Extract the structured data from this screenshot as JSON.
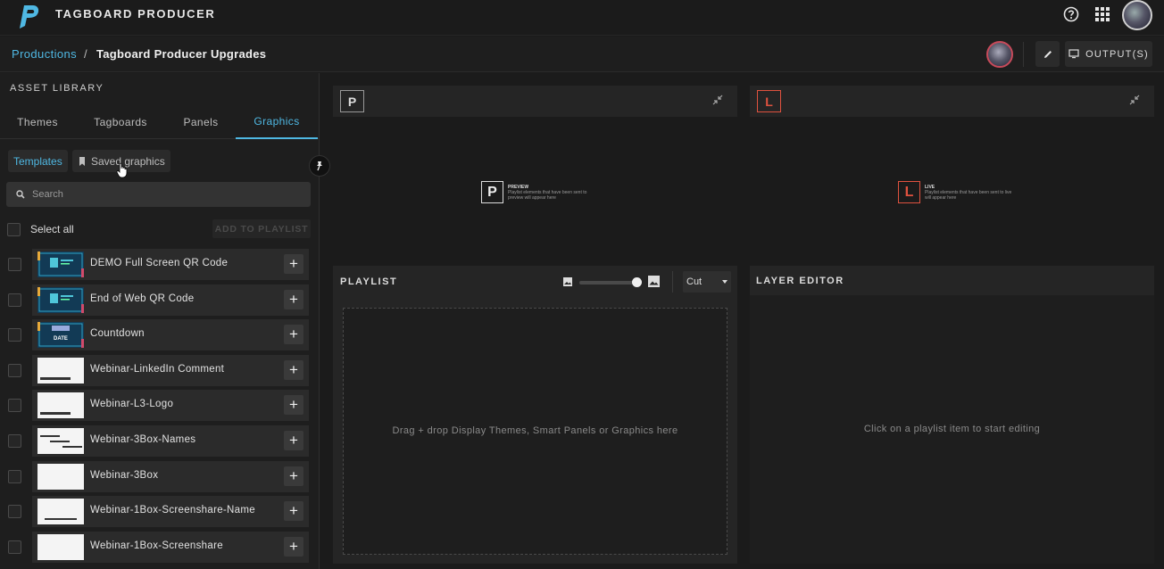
{
  "app": {
    "title": "TAGBOARD PRODUCER"
  },
  "breadcrumb": {
    "root": "Productions",
    "separator": "/",
    "current": "Tagboard Producer Upgrades"
  },
  "header": {
    "output_label": "OUTPUT(S)"
  },
  "asset_library": {
    "heading": "ASSET LIBRARY",
    "tabs": [
      {
        "label": "Themes",
        "active": false
      },
      {
        "label": "Tagboards",
        "active": false
      },
      {
        "label": "Panels",
        "active": false
      },
      {
        "label": "Graphics",
        "active": true
      }
    ],
    "filters": {
      "templates": "Templates",
      "saved": "Saved graphics"
    },
    "search_placeholder": "Search",
    "select_all": "Select all",
    "add_to_playlist": "ADD TO PLAYLIST",
    "items": [
      {
        "name": "DEMO Full Screen QR Code",
        "thumb": "qr"
      },
      {
        "name": "End of Web QR Code",
        "thumb": "qr"
      },
      {
        "name": "Countdown",
        "thumb": "date"
      },
      {
        "name": "Webinar-LinkedIn Comment",
        "thumb": "blank-bar"
      },
      {
        "name": "Webinar-L3-Logo",
        "thumb": "blank-bar"
      },
      {
        "name": "Webinar-3Box-Names",
        "thumb": "box-names"
      },
      {
        "name": "Webinar-3Box",
        "thumb": "blank"
      },
      {
        "name": "Webinar-1Box-Screenshare-Name",
        "thumb": "blank-line"
      },
      {
        "name": "Webinar-1Box-Screenshare",
        "thumb": "blank"
      }
    ],
    "thumb_date_text": "DATE"
  },
  "preview": {
    "badge": "P",
    "placeholder_title": "PREVIEW",
    "placeholder_text": "Playlist elements that have been sent to preview will appear here",
    "color": "#dddddd"
  },
  "live": {
    "badge": "L",
    "placeholder_title": "LIVE",
    "placeholder_text": "Playlist elements that have been sent to live will appear here",
    "color": "#e0523f"
  },
  "playlist": {
    "title": "PLAYLIST",
    "transition": "Cut",
    "drop_text": "Drag + drop Display Themes, Smart Panels or Graphics here"
  },
  "layer_editor": {
    "title": "LAYER EDITOR",
    "empty_text": "Click on a playlist item to start editing"
  },
  "colors": {
    "accent": "#4fb8e3",
    "live": "#e0523f",
    "background": "#1b1b1b"
  }
}
